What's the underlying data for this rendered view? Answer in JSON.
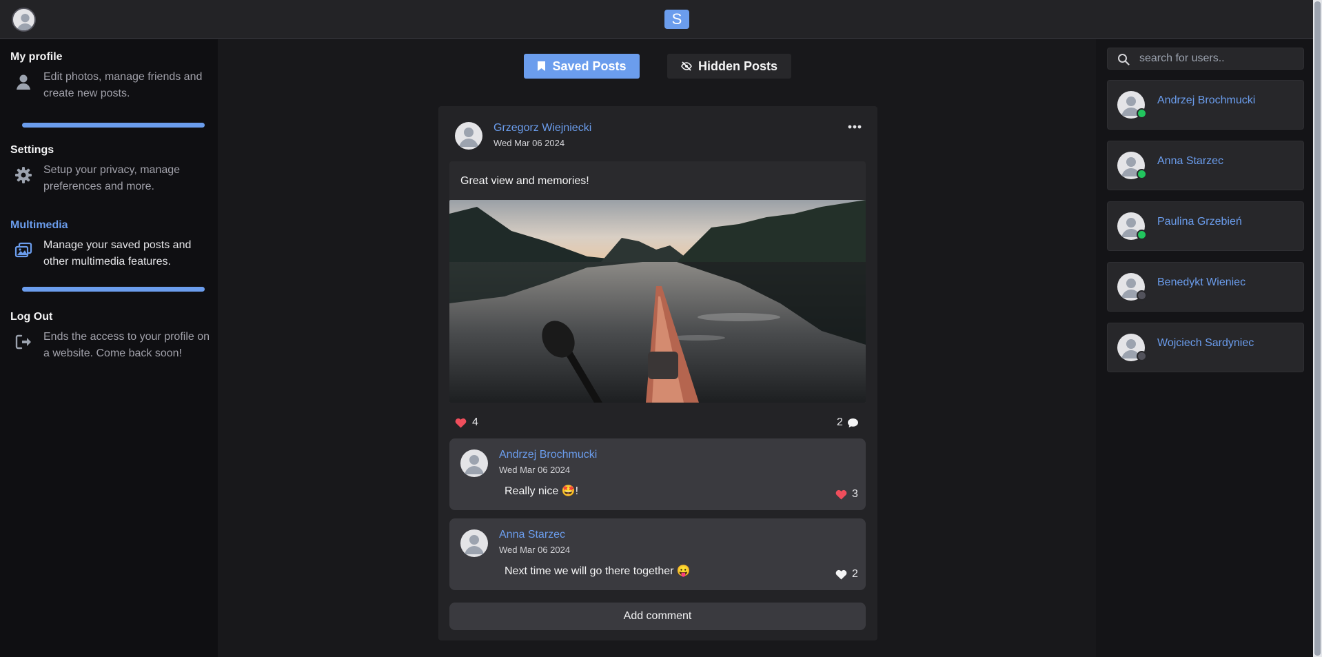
{
  "brand": {
    "logo_letter": "S",
    "accent_color": "#6b9ded"
  },
  "sidebar": {
    "items": [
      {
        "title": "My profile",
        "description": "Edit photos, manage friends and create new posts.",
        "icon": "user-icon",
        "active": false
      },
      {
        "title": "Settings",
        "description": "Setup your privacy, manage preferences and more.",
        "icon": "gear-icon",
        "active": false
      },
      {
        "title": "Multimedia",
        "description": "Manage your saved posts and other multimedia features.",
        "icon": "images-icon",
        "active": true
      },
      {
        "title": "Log Out",
        "description": "Ends the access to your profile on a website. Come back soon!",
        "icon": "logout-icon",
        "active": false
      }
    ]
  },
  "tabs": {
    "saved_label": "Saved Posts",
    "hidden_label": "Hidden Posts"
  },
  "post": {
    "author": "Grzegorz Wiejniecki",
    "date": "Wed Mar 06 2024",
    "text": "Great view and memories!",
    "likes": "4",
    "comment_count": "2",
    "comments": [
      {
        "author": "Andrzej Brochmucki",
        "date": "Wed Mar 06 2024",
        "text": "Really nice 🤩!",
        "likes": "3",
        "liked": true
      },
      {
        "author": "Anna Starzec",
        "date": "Wed Mar 06 2024",
        "text": "Next time we will go there together 😛",
        "likes": "2",
        "liked": false
      }
    ],
    "add_comment_label": "Add comment"
  },
  "search": {
    "placeholder": "search for users.."
  },
  "users": [
    {
      "name": "Andrzej Brochmucki",
      "online": true
    },
    {
      "name": "Anna Starzec",
      "online": true
    },
    {
      "name": "Paulina Grzebień",
      "online": true
    },
    {
      "name": "Benedykt Wieniec",
      "online": false
    },
    {
      "name": "Wojciech Sardyniec",
      "online": false
    }
  ],
  "status_colors": {
    "online": "#22c55e",
    "offline": "#52525b"
  }
}
